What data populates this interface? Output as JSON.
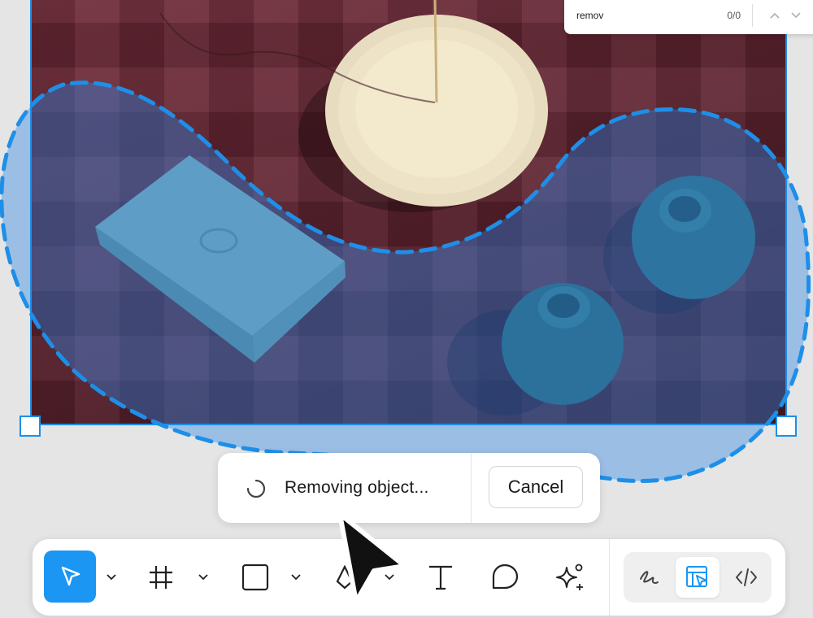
{
  "find_bar": {
    "query": "remov",
    "match_count": "0/0",
    "prev_icon": "chevron-up-icon",
    "next_icon": "chevron-down-icon"
  },
  "status_pill": {
    "message": "Removing object...",
    "cancel_label": "Cancel",
    "spinner_icon": "loading-spinner-icon"
  },
  "toolbar": {
    "tools": [
      {
        "name": "move",
        "icon": "cursor-arrow-icon",
        "active": true,
        "has_dropdown": true
      },
      {
        "name": "frame",
        "icon": "frame-hash-icon",
        "active": false,
        "has_dropdown": true
      },
      {
        "name": "shape",
        "icon": "rectangle-icon",
        "active": false,
        "has_dropdown": true
      },
      {
        "name": "pen",
        "icon": "pen-icon",
        "active": false,
        "has_dropdown": true
      },
      {
        "name": "text",
        "icon": "text-icon",
        "active": false,
        "has_dropdown": false
      },
      {
        "name": "comment",
        "icon": "comment-bubble-icon",
        "active": false,
        "has_dropdown": false
      },
      {
        "name": "ai",
        "icon": "sparkle-ai-icon",
        "active": false,
        "has_dropdown": false
      }
    ],
    "modes": [
      {
        "name": "draw",
        "icon": "squiggle-draw-icon",
        "active": false
      },
      {
        "name": "design",
        "icon": "design-layout-icon",
        "active": true
      },
      {
        "name": "dev",
        "icon": "code-brackets-icon",
        "active": false
      }
    ]
  },
  "colors": {
    "accent": "#1b96f3",
    "selection": "#1e8fe8",
    "canvas_bg": "#e5e5e5",
    "photo_tablecloth": "#6e2a37",
    "vase": "#2e6a72",
    "book": "#86b5b6",
    "dish": "#e8dcc0"
  }
}
